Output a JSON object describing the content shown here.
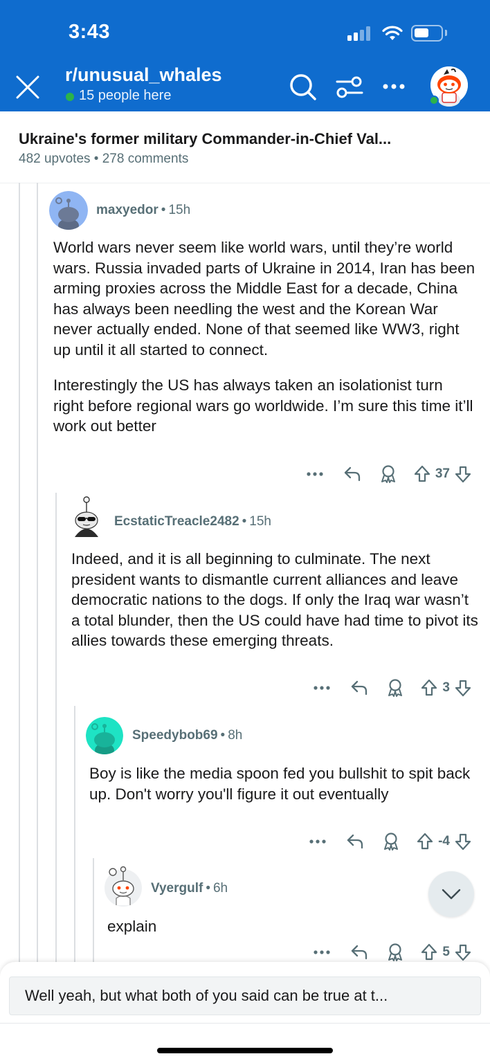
{
  "status_bar": {
    "time": "3:43"
  },
  "header": {
    "subreddit": "r/unusual_whales",
    "online_text": "15 people here",
    "online_color": "#2cb34a",
    "background": "#0f6cce",
    "icons": [
      "close-icon",
      "search-icon",
      "filter-icon",
      "more-icon",
      "profile-avatar"
    ]
  },
  "post": {
    "title": "Ukraine's former military Commander-in-Chief Val...",
    "meta": "482 upvotes • 278 comments"
  },
  "comments": [
    {
      "author": "maxyedor",
      "time": "15h",
      "avatar_color": "#8fb5f3",
      "body": [
        "World wars never seem like world wars, until they’re world wars. Russia invaded parts of Ukraine in 2014, Iran has been arming proxies across the Middle East for a decade, China has always been needling the west and the Korean War never actually ended. None of that seemed like WW3, right up until it all started to connect.",
        "Interestingly the US has always taken an isolationist turn right before regional wars go worldwide. I’m sure this time it’ll work out better"
      ],
      "score": "37"
    },
    {
      "author": "EcstaticTreacle2482",
      "time": "15h",
      "avatar_color": "#ffffff",
      "body": [
        "Indeed, and it is all beginning to culminate. The next president wants to dismantle current alliances and leave democratic nations to the dogs. If only the Iraq war wasn’t a total blunder, then the US could have had time to pivot its allies towards these emerging threats."
      ],
      "score": "3"
    },
    {
      "author": "Speedybob69",
      "time": "8h",
      "avatar_color": "#1ee3c4",
      "body": [
        "Boy is like the media spoon fed you bullshit to spit back up. Don't worry you'll figure it out eventually"
      ],
      "score": "-4"
    },
    {
      "author": "Vyergulf",
      "time": "6h",
      "avatar_color": "#eef0f2",
      "body": [
        "explain"
      ],
      "score": "5"
    }
  ],
  "composer": {
    "text": "Well yeah, but what both of you said can be true at t..."
  }
}
